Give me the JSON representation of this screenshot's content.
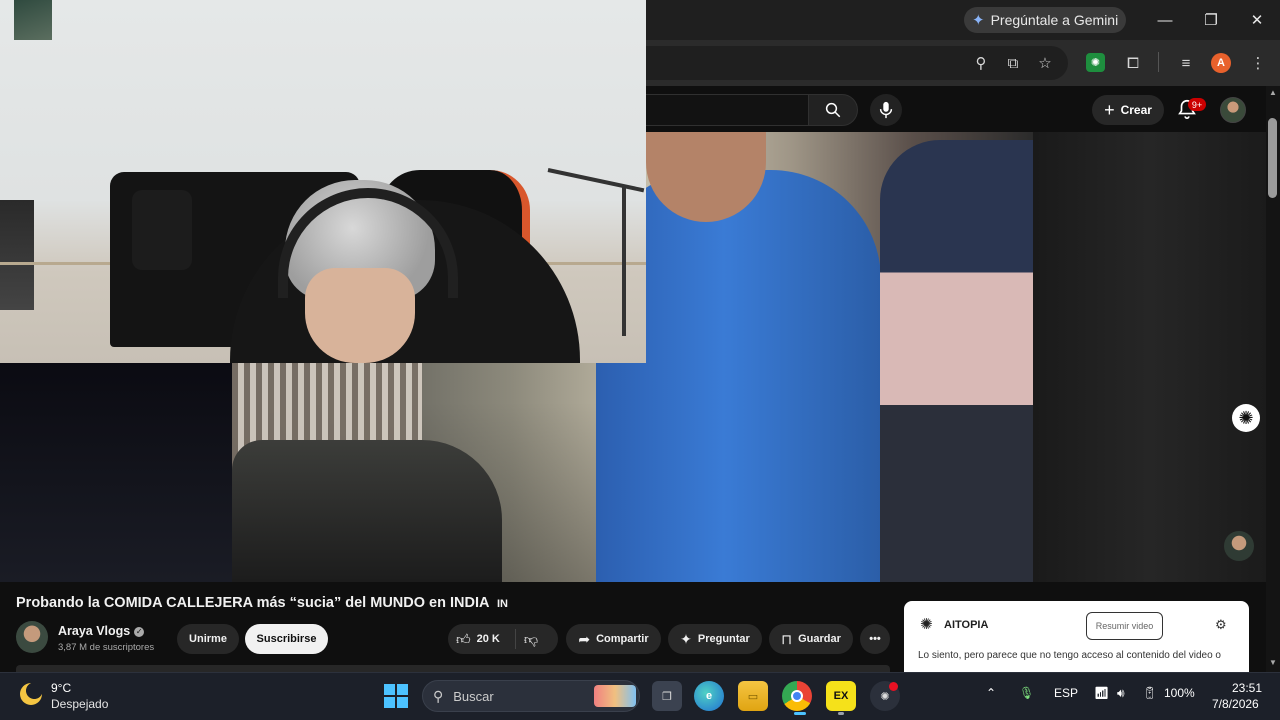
{
  "browser": {
    "gemini_label": "Pregúntale a Gemini",
    "profile_initial": "A"
  },
  "youtube": {
    "create_label": "Crear",
    "notification_count": "9+"
  },
  "video": {
    "title": "Probando la COMIDA CALLEJERA más “sucia” del MUNDO en INDIA",
    "title_flag": "IN",
    "channel_name": "Araya Vlogs",
    "subscribers": "3,87 M de suscriptores",
    "join_label": "Unirme",
    "subscribe_label": "Suscribirse",
    "like_count": "20 K",
    "share_label": "Compartir",
    "ask_label": "Preguntar",
    "save_label": "Guardar"
  },
  "aitopia": {
    "name": "AITOPIA",
    "summary_button": "Resumir video",
    "message": "Lo siento, pero parece que no tengo acceso al contenido del video o"
  },
  "taskbar": {
    "weather_temp": "9°C",
    "weather_desc": "Despejado",
    "search_placeholder": "Buscar",
    "language": "ESP",
    "battery": "100%",
    "time": "23:51",
    "date": "7/8/2026",
    "app_ex_label": "EX"
  },
  "colors": {
    "youtube_bg": "#0f0f0f",
    "chip_bg": "#272727",
    "windows_accent": "#4cc2ff",
    "notification_red": "#cc0000"
  }
}
